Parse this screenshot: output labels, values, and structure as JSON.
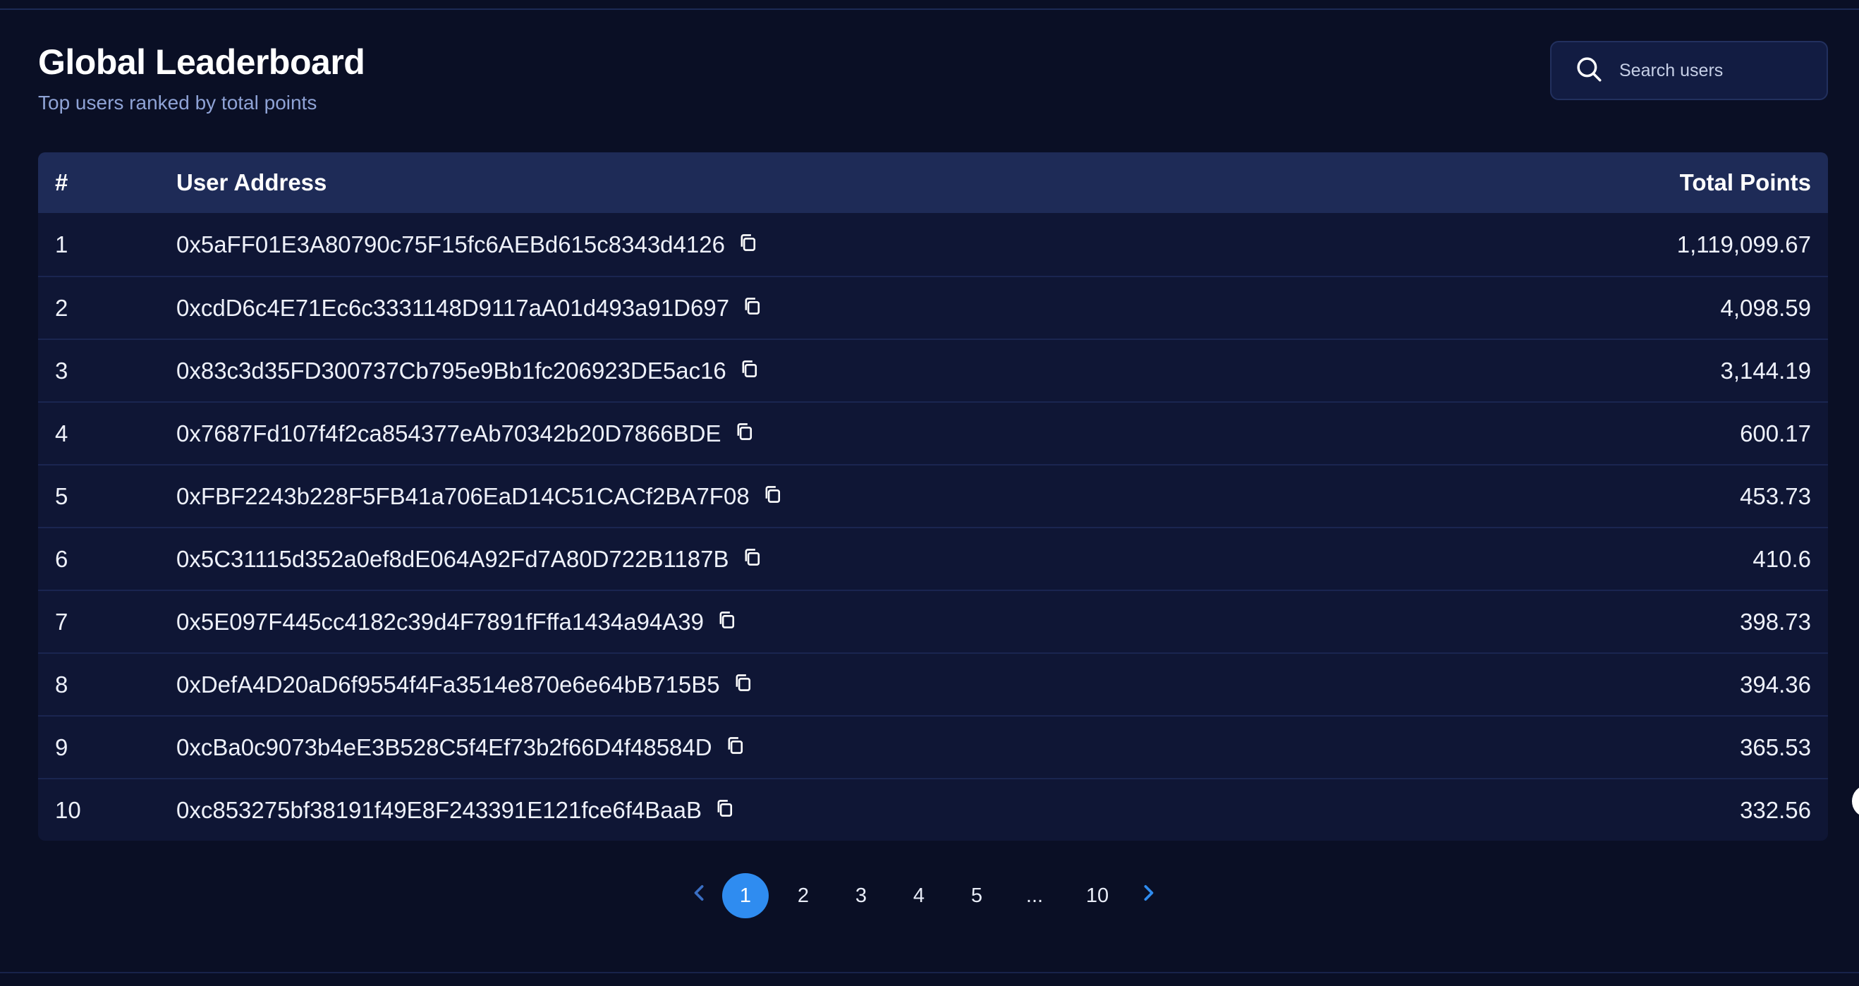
{
  "header": {
    "title": "Global Leaderboard",
    "subtitle": "Top users ranked by total points"
  },
  "search": {
    "placeholder": "Search users",
    "icon": "search-icon"
  },
  "table": {
    "columns": [
      "#",
      "User Address",
      "Total Points"
    ],
    "rows": [
      {
        "rank": "1",
        "address": "0x5aFF01E3A80790c75F15fc6AEBd615c8343d4126",
        "points": "1,119,099.67"
      },
      {
        "rank": "2",
        "address": "0xcdD6c4E71Ec6c3331148D9117aA01d493a91D697",
        "points": "4,098.59"
      },
      {
        "rank": "3",
        "address": "0x83c3d35FD300737Cb795e9Bb1fc206923DE5ac16",
        "points": "3,144.19"
      },
      {
        "rank": "4",
        "address": "0x7687Fd107f4f2ca854377eAb70342b20D7866BDE",
        "points": "600.17"
      },
      {
        "rank": "5",
        "address": "0xFBF2243b228F5FB41a706EaD14C51CACf2BA7F08",
        "points": "453.73"
      },
      {
        "rank": "6",
        "address": "0x5C31115d352a0ef8dE064A92Fd7A80D722B1187B",
        "points": "410.6"
      },
      {
        "rank": "7",
        "address": "0x5E097F445cc4182c39d4F7891fFffa1434a94A39",
        "points": "398.73"
      },
      {
        "rank": "8",
        "address": "0xDefA4D20aD6f9554f4Fa3514e870e6e64bB715B5",
        "points": "394.36"
      },
      {
        "rank": "9",
        "address": "0xcBa0c9073b4eE3B528C5f4Ef73b2f66D4f48584D",
        "points": "365.53"
      },
      {
        "rank": "10",
        "address": "0xc853275bf38191f49E8F243391E121fce6f4BaaB",
        "points": "332.56"
      }
    ],
    "copy_icon": "copy-icon"
  },
  "pagination": {
    "pages": [
      "1",
      "2",
      "3",
      "4",
      "5"
    ],
    "ellipsis": "...",
    "last": "10",
    "current": "1",
    "prev_icon": "chevron-left-icon",
    "next_icon": "chevron-right-icon"
  },
  "colors": {
    "background": "#0a0f25",
    "header_row": "#1e2b57",
    "accent": "#2f8cf0",
    "subtitle": "#8fa3d6"
  }
}
